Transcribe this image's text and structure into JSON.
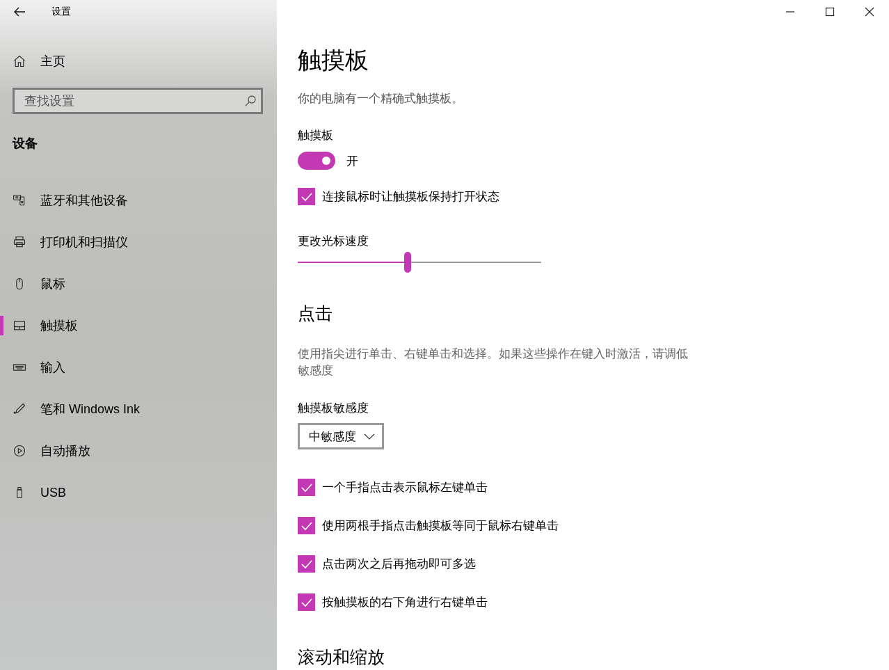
{
  "window": {
    "title": "设置"
  },
  "sidebar": {
    "home": "主页",
    "search": {
      "placeholder": "查找设置"
    },
    "section": "设备",
    "items": [
      {
        "label": "蓝牙和其他设备",
        "selected": false
      },
      {
        "label": "打印机和扫描仪",
        "selected": false
      },
      {
        "label": "鼠标",
        "selected": false
      },
      {
        "label": "触摸板",
        "selected": true
      },
      {
        "label": "输入",
        "selected": false
      },
      {
        "label": "笔和 Windows Ink",
        "selected": false
      },
      {
        "label": "自动播放",
        "selected": false
      },
      {
        "label": "USB",
        "selected": false
      }
    ]
  },
  "page": {
    "title": "触摸板",
    "subtitle": "你的电脑有一个精确式触摸板。",
    "touchpad": {
      "label": "触摸板",
      "on": true,
      "state_label": "开"
    },
    "keep_on_checkbox": {
      "label": "连接鼠标时让触摸板保持打开状态",
      "checked": true
    },
    "cursor_speed": {
      "label": "更改光标速度",
      "level": 0.45
    },
    "taps": {
      "heading": "点击",
      "description": "使用指尖进行单击、右键单击和选择。如果这些操作在键入时激活，请调低敏感度",
      "sensitivity": {
        "label": "触摸板敏感度",
        "value": "中敏感度"
      },
      "options": [
        {
          "label": "一个手指点击表示鼠标左键单击",
          "checked": true
        },
        {
          "label": "使用两根手指点击触摸板等同于鼠标右键单击",
          "checked": true
        },
        {
          "label": "点击两次之后再拖动即可多选",
          "checked": true
        },
        {
          "label": "按触摸板的右下角进行右键单击",
          "checked": true
        }
      ]
    },
    "scroll_heading": "滚动和缩放"
  }
}
